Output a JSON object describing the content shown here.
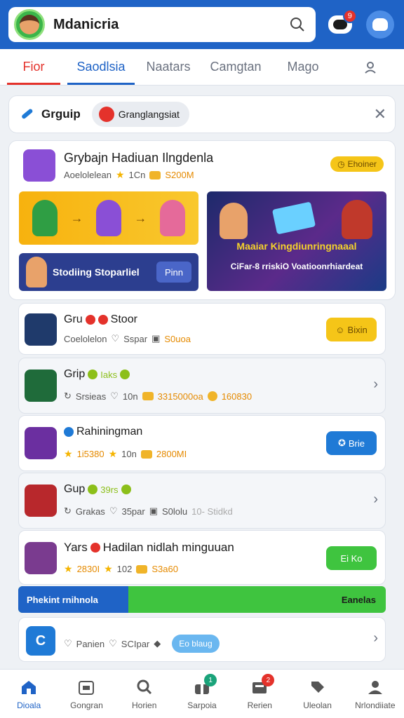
{
  "header": {
    "title": "Mdanicria",
    "notif_count": "9",
    "colors": {
      "bar": "#1f63c6"
    }
  },
  "tabs": [
    {
      "label": "Fior",
      "state": "active-red"
    },
    {
      "label": "Saodlsia",
      "state": "active-blue"
    },
    {
      "label": "Naatars",
      "state": ""
    },
    {
      "label": "Camgtan",
      "state": ""
    },
    {
      "label": "Mago",
      "state": ""
    },
    {
      "icon": "person-icon"
    }
  ],
  "filter": {
    "label": "Grguip",
    "chip": "Granglangsiat"
  },
  "featured": {
    "title": "Grybajn Hadiuan Ilngdenla",
    "meta_a": "Aoelolelean",
    "rating": "1Cn",
    "coins": "S200M",
    "badge": "Ehoiner",
    "banner_b_text": "Stodiing Stoparliel",
    "banner_b_button": "Pinn",
    "banner_c_title": "Maaiar Kingdiunringnaaal",
    "banner_c_sub": "CiFar-8 rriskiO Voatioonrhiardeat"
  },
  "rows": [
    {
      "title": "Gru",
      "tag": "Stoor",
      "meta_a": "Coelolelon",
      "meta_b": "Sspar",
      "meta_c": "S0uoa",
      "button": "Bixin"
    },
    {
      "title": "Grip",
      "tag": "Iaks",
      "meta_a": "Srsieas",
      "meta_b": "10n",
      "meta_c": "3315000oa",
      "meta_d": "160830"
    },
    {
      "title": "Rahiningman",
      "meta_a": "1i5380",
      "meta_b": "10n",
      "meta_c": "2800MI",
      "button": "Brie"
    },
    {
      "title": "Gup",
      "tag": "39rs",
      "meta_a": "Grakas",
      "meta_b": "35par",
      "meta_c": "S0lolu",
      "meta_d": "10- Stidkd"
    },
    {
      "title": "Yars",
      "title2": "Hadilan nidlah minguuan",
      "meta_a": "2830I",
      "meta_b": "102",
      "meta_c": "S3a60",
      "button": "Ei Ko"
    }
  ],
  "progress": {
    "label": "Phekint rnihnola",
    "right": "Eanelas",
    "value": 0.3
  },
  "last_row": {
    "meta_a": "Panien",
    "meta_b": "SCIpar",
    "pill": "Eo blaug"
  },
  "bottom_nav": [
    {
      "label": "Dioala",
      "icon": "home-icon",
      "active": true
    },
    {
      "label": "Gongran",
      "icon": "store-icon"
    },
    {
      "label": "Horien",
      "icon": "search-icon"
    },
    {
      "label": "Sarpoia",
      "icon": "gift-icon",
      "badge": "1",
      "badge_color": "green"
    },
    {
      "label": "Rerien",
      "icon": "mail-icon",
      "badge": "2",
      "badge_color": "red"
    },
    {
      "label": "Uleolan",
      "icon": "tag-icon"
    },
    {
      "label": "Nrlondiiate",
      "icon": "profile-icon"
    }
  ]
}
